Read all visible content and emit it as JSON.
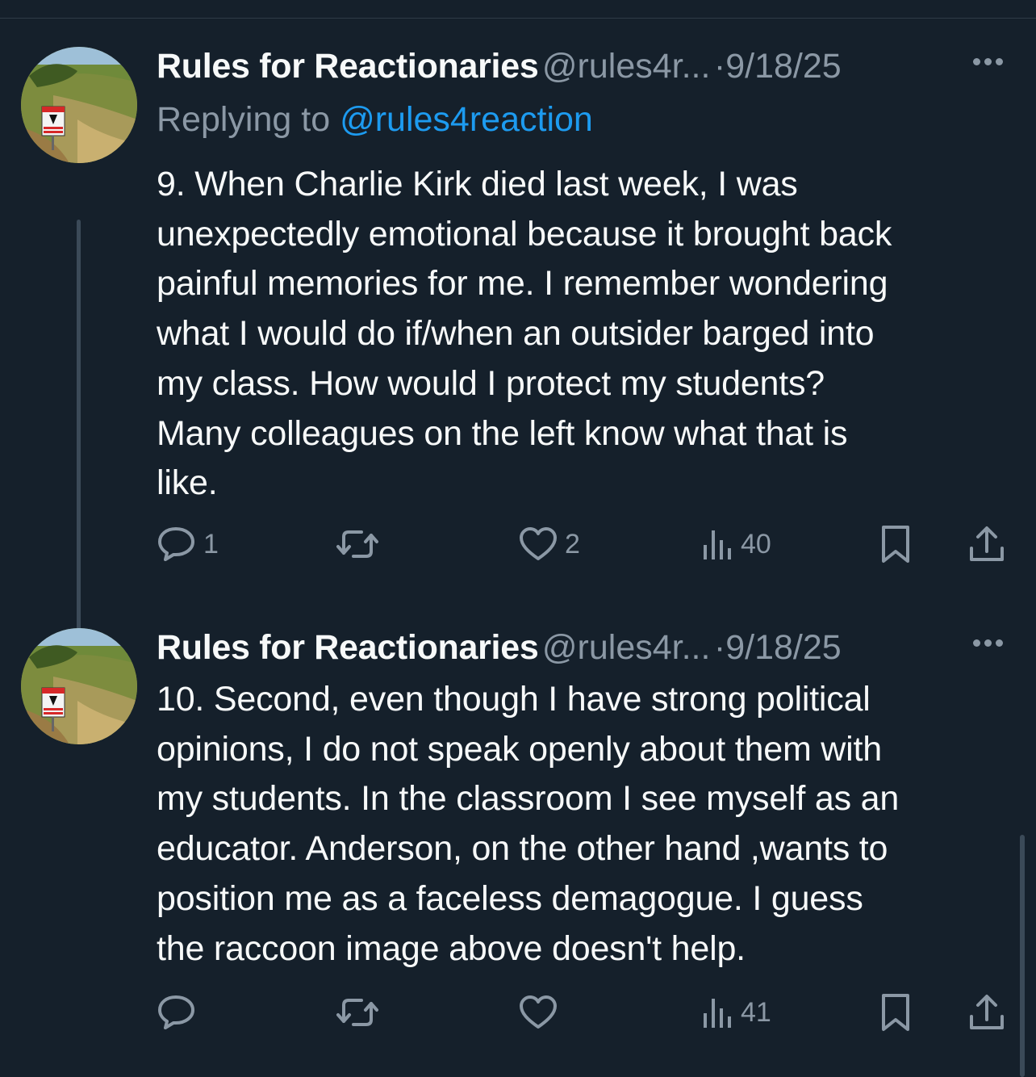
{
  "tweets": [
    {
      "author_name": "Rules for Reactionaries",
      "handle": "@rules4r...",
      "separator": "·",
      "date": "9/18/25",
      "replying_to_prefix": "Replying to ",
      "replying_to_handle": "@rules4reaction",
      "text": "9. When Charlie Kirk died last week, I was\nunexpectedly emotional because it brought back\npainful memories for me. I remember wondering\nwhat I would do if/when an outsider barged into\nmy class. How would I protect my students?\nMany colleagues on the left know what that is\nlike.",
      "replies": "1",
      "reposts": "",
      "likes": "2",
      "views": "40"
    },
    {
      "author_name": "Rules for Reactionaries",
      "handle": "@rules4r...",
      "separator": "·",
      "date": "9/18/25",
      "text": "10. Second, even though I have strong political\nopinions, I do not speak openly about them with\nmy students. In the classroom I see myself as an\neducator. Anderson, on the other hand ,wants to\nposition me as a faceless demagogue. I guess\nthe raccoon image above doesn't help.",
      "replies": "",
      "reposts": "",
      "likes": "",
      "views": "41"
    }
  ],
  "icons": {
    "reply": "speech-bubble",
    "repost": "retweet-arrows",
    "like": "heart",
    "views": "bar-chart",
    "bookmark": "bookmark",
    "share": "share-upload"
  },
  "colors": {
    "background": "#15202b",
    "text": "#f7f9f9",
    "secondary": "#8b98a5",
    "link": "#1d9bf0"
  }
}
